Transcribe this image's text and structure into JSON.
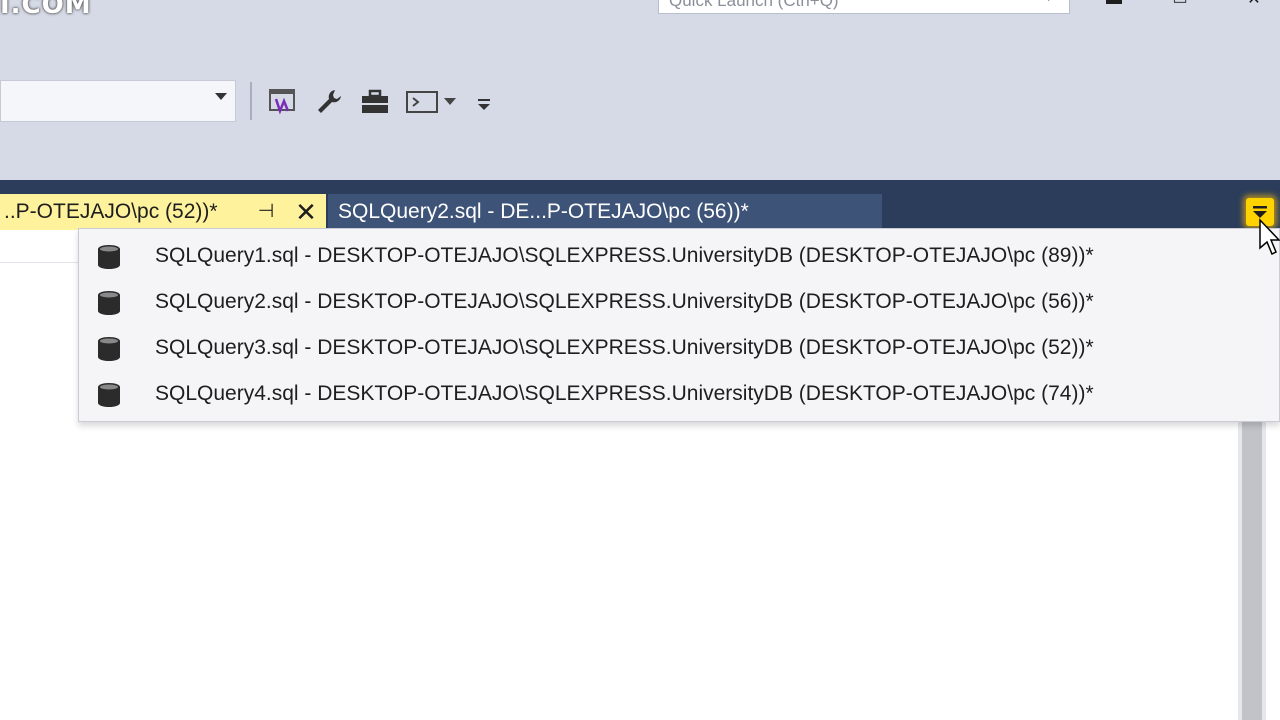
{
  "titlebar": {
    "logo_text": "I.COM",
    "quick_launch_placeholder": "Quick Launch (Ctrl+Q)",
    "window_controls": [
      "minimize-icon",
      "maximize-icon",
      "close-icon"
    ]
  },
  "toolbar": {
    "combo_value": "",
    "buttons": [
      {
        "name": "vs-sln-icon"
      },
      {
        "name": "wrench-icon"
      },
      {
        "name": "toolbox-icon"
      },
      {
        "name": "command-window-icon"
      },
      {
        "name": "dropdown-arrow-icon"
      },
      {
        "name": "toolbar-overflow-icon"
      }
    ]
  },
  "tabs": {
    "active": {
      "label": "..P-OTEJAJO\\pc (52))*",
      "pin_glyph": "⊣",
      "close_glyph": "✕"
    },
    "inactive": {
      "label": "SQLQuery2.sql - DE...P-OTEJAJO\\pc (56))*"
    }
  },
  "open_documents_dropdown": {
    "items": [
      {
        "label": "SQLQuery1.sql - DESKTOP-OTEJAJO\\SQLEXPRESS.UniversityDB (DESKTOP-OTEJAJO\\pc (89))*",
        "icon": "database-icon"
      },
      {
        "label": "SQLQuery2.sql - DESKTOP-OTEJAJO\\SQLEXPRESS.UniversityDB (DESKTOP-OTEJAJO\\pc (56))*",
        "icon": "database-icon"
      },
      {
        "label": "SQLQuery3.sql - DESKTOP-OTEJAJO\\SQLEXPRESS.UniversityDB (DESKTOP-OTEJAJO\\pc (52))*",
        "icon": "database-icon"
      },
      {
        "label": "SQLQuery4.sql - DESKTOP-OTEJAJO\\SQLEXPRESS.UniversityDB (DESKTOP-OTEJAJO\\pc (74))*",
        "icon": "database-icon"
      }
    ]
  },
  "colors": {
    "chrome": "#d5dae6",
    "tab_strip": "#2b3d5a",
    "active_tab": "#fff29d",
    "inactive_tab": "#3e5378",
    "overflow_highlight": "#ffd200"
  }
}
